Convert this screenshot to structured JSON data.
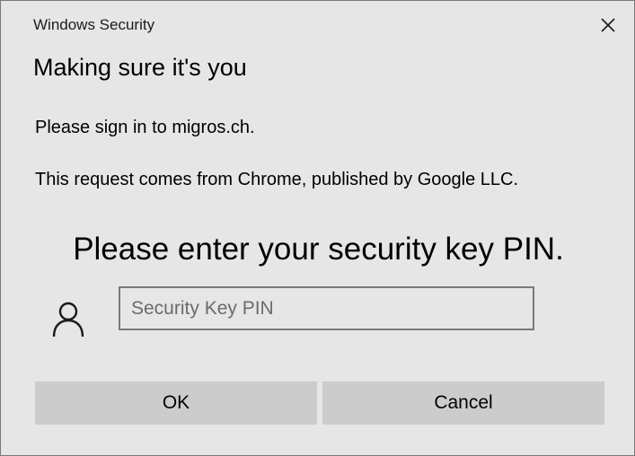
{
  "window": {
    "app_title": "Windows Security"
  },
  "dialog": {
    "heading": "Making sure it's you",
    "sign_in_text": "Please sign in to migros.ch.",
    "request_text": "This request comes from Chrome, published by Google LLC.",
    "pin_prompt": "Please enter your security key PIN."
  },
  "pin_field": {
    "placeholder": "Security Key PIN",
    "value": ""
  },
  "buttons": {
    "ok_label": "OK",
    "cancel_label": "Cancel"
  },
  "icons": {
    "close": "close-icon",
    "user": "user-icon"
  },
  "colors": {
    "background": "#e6e6e6",
    "button": "#cccccc",
    "input_border": "#7a7a7a"
  }
}
